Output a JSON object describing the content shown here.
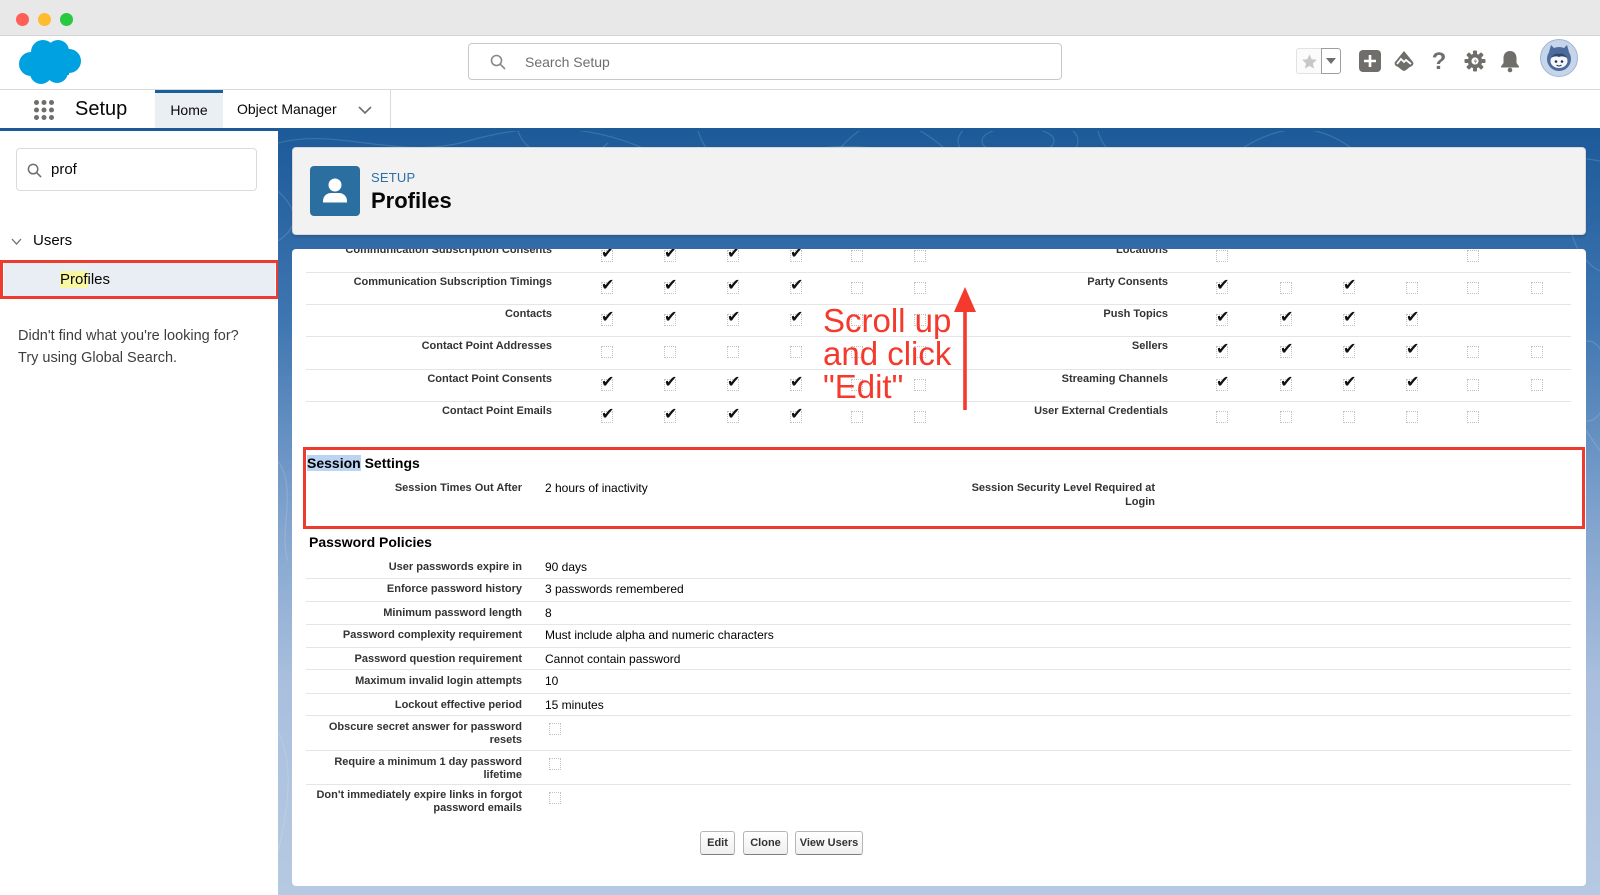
{
  "window": {
    "traffic_lights": [
      {
        "name": "close",
        "color": "#ff5f57"
      },
      {
        "name": "minimize",
        "color": "#febc2e"
      },
      {
        "name": "zoom",
        "color": "#28c840"
      }
    ]
  },
  "global_header": {
    "search": {
      "placeholder": "Search Setup",
      "value": ""
    },
    "icons": [
      "star-icon",
      "favorites-dropdown-icon",
      "plus-icon",
      "trailhead-icon",
      "help-icon",
      "gear-icon",
      "bell-icon",
      "user-avatar"
    ]
  },
  "nav": {
    "app_name": "Setup",
    "tabs": [
      {
        "label": "Home",
        "active": true
      },
      {
        "label": "Object Manager",
        "active": false,
        "has_menu": true
      }
    ]
  },
  "sidebar": {
    "quick_find": {
      "value": "prof"
    },
    "group": {
      "label": "Users",
      "expanded": true
    },
    "items": [
      {
        "label": "Profiles",
        "match": "Prof",
        "rest": "iles",
        "selected": true
      }
    ],
    "help_text": [
      "Didn't find what you're looking for?",
      "Try using Global Search."
    ]
  },
  "page_header": {
    "eyebrow": "SETUP",
    "title": "Profiles",
    "icon": "user-icon"
  },
  "object_permissions": {
    "left": [
      {
        "label": "Communication Subscription Consents",
        "cells": [
          "check",
          "check",
          "check",
          "check",
          "empty",
          "empty"
        ]
      },
      {
        "label": "Communication Subscription Timings",
        "cells": [
          "check",
          "check",
          "check",
          "check",
          "empty",
          "empty"
        ]
      },
      {
        "label": "Contacts",
        "cells": [
          "check",
          "check",
          "check",
          "check",
          "empty",
          "empty"
        ]
      },
      {
        "label": "Contact Point Addresses",
        "cells": [
          "empty",
          "empty",
          "empty",
          "empty",
          "empty",
          "empty"
        ]
      },
      {
        "label": "Contact Point Consents",
        "cells": [
          "check",
          "check",
          "check",
          "check",
          "empty",
          "empty"
        ]
      },
      {
        "label": "Contact Point Emails",
        "cells": [
          "check",
          "check",
          "check",
          "check",
          "empty",
          "empty"
        ]
      }
    ],
    "right": [
      {
        "label": "Locations",
        "cells": [
          "empty",
          null,
          null,
          null,
          "empty",
          null
        ]
      },
      {
        "label": "Party Consents",
        "cells": [
          "check",
          "empty",
          "check",
          "empty",
          "empty",
          "empty"
        ]
      },
      {
        "label": "Push Topics",
        "cells": [
          "check",
          "check",
          "check",
          "check",
          null,
          null
        ]
      },
      {
        "label": "Sellers",
        "cells": [
          "check",
          "check",
          "check",
          "check",
          "empty",
          "empty"
        ]
      },
      {
        "label": "Streaming Channels",
        "cells": [
          "check",
          "check",
          "check",
          "check",
          "empty",
          "empty"
        ]
      },
      {
        "label": "User External Credentials",
        "cells": [
          "empty",
          "empty",
          "empty",
          "empty",
          "empty",
          null
        ]
      }
    ]
  },
  "session_settings": {
    "heading": {
      "highlight": "Session",
      "rest": " Settings"
    },
    "fields": [
      {
        "label": "Session Times Out After",
        "value": "2 hours of inactivity"
      },
      {
        "label": "Session Security Level Required at Login",
        "value": ""
      }
    ]
  },
  "password_policies": {
    "heading": "Password Policies",
    "fields": [
      {
        "label": "User passwords expire in",
        "value": "90 days"
      },
      {
        "label": "Enforce password history",
        "value": "3 passwords remembered"
      },
      {
        "label": "Minimum password length",
        "value": "8"
      },
      {
        "label": "Password complexity requirement",
        "value": "Must include alpha and numeric characters"
      },
      {
        "label": "Password question requirement",
        "value": "Cannot contain password"
      },
      {
        "label": "Maximum invalid login attempts",
        "value": "10"
      },
      {
        "label": "Lockout effective period",
        "value": "15 minutes"
      },
      {
        "label": "Obscure secret answer for password resets",
        "checked": false
      },
      {
        "label": "Require a minimum 1 day password lifetime",
        "checked": false
      },
      {
        "label": "Don't immediately expire links in forgot password emails",
        "checked": false
      }
    ]
  },
  "actions": [
    {
      "label": "Edit"
    },
    {
      "label": "Clone"
    },
    {
      "label": "View Users"
    }
  ],
  "annotation": {
    "lines": [
      "Scroll up",
      "and click",
      "\"Edit\""
    ],
    "arrow": "up-arrow",
    "color": "#f4392d"
  },
  "highlight_boxes": {
    "color": "#ee3b2f",
    "targets": [
      "sidebar-profiles",
      "session-settings"
    ]
  },
  "theme": {
    "brand_blue": "#00a1e0",
    "header_icon_bg": "#2a6f9f",
    "active_tab_border": "#1b5f9a"
  }
}
